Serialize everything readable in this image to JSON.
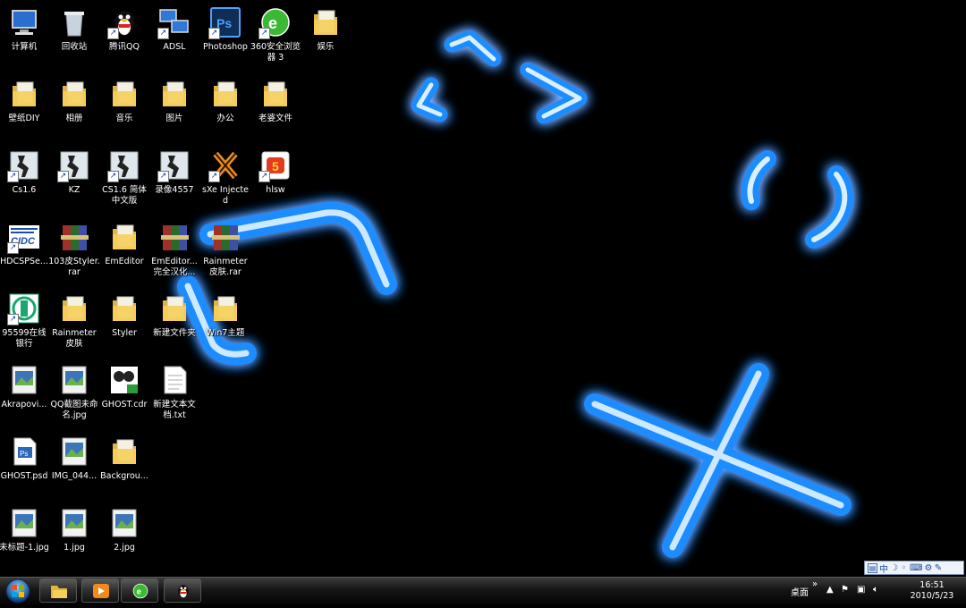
{
  "desktop": {
    "icons": [
      {
        "label": "计算机",
        "icon": "computer-icon"
      },
      {
        "label": "回收站",
        "icon": "recycle-bin-icon"
      },
      {
        "label": "腾讯QQ",
        "icon": "qq-penguin-icon"
      },
      {
        "label": "ADSL",
        "icon": "network-icon"
      },
      {
        "label": "Photoshop",
        "icon": "photoshop-icon"
      },
      {
        "label": "360安全浏览器 3",
        "icon": "browser-360-icon"
      },
      {
        "label": "娱乐",
        "icon": "folder-icon"
      },
      {
        "label": "壁纸DIY",
        "icon": "folder-icon"
      },
      {
        "label": "相册",
        "icon": "folder-icon"
      },
      {
        "label": "音乐",
        "icon": "folder-icon"
      },
      {
        "label": "图片",
        "icon": "folder-icon"
      },
      {
        "label": "办公",
        "icon": "folder-icon"
      },
      {
        "label": "老婆文件",
        "icon": "folder-icon"
      },
      {
        "label": "Cs1.6",
        "icon": "counter-strike-icon"
      },
      {
        "label": "KZ",
        "icon": "counter-strike-icon"
      },
      {
        "label": "CS1.6 简体中文版",
        "icon": "counter-strike-icon"
      },
      {
        "label": "录像4557",
        "icon": "counter-strike-icon"
      },
      {
        "label": "sXe Injected",
        "icon": "sxe-icon"
      },
      {
        "label": "hlsw",
        "icon": "hlsw-icon"
      },
      {
        "label": "HDCSPSe...",
        "icon": "cidc-icon"
      },
      {
        "label": "103皮Styler.rar",
        "icon": "rar-archive-icon"
      },
      {
        "label": "EmEditor",
        "icon": "folder-icon"
      },
      {
        "label": "EmEditor...完全汉化...",
        "icon": "rar-archive-icon"
      },
      {
        "label": "Rainmeter皮肤.rar",
        "icon": "rar-archive-icon"
      },
      {
        "label": "95599在线银行",
        "icon": "bank-icon"
      },
      {
        "label": "Rainmeter皮肤",
        "icon": "folder-icon"
      },
      {
        "label": "Styler",
        "icon": "folder-icon"
      },
      {
        "label": "新建文件夹",
        "icon": "folder-icon"
      },
      {
        "label": "Win7主题",
        "icon": "folder-icon"
      },
      {
        "label": "Akrapovi...",
        "icon": "image-file-icon"
      },
      {
        "label": "QQ截图未命名.jpg",
        "icon": "image-file-icon"
      },
      {
        "label": "GHOST.cdr",
        "icon": "coreldraw-file-icon"
      },
      {
        "label": "新建文本文档.txt",
        "icon": "text-file-icon"
      },
      {
        "label": "GHOST.psd",
        "icon": "psd-file-icon"
      },
      {
        "label": "IMG_044...",
        "icon": "image-file-icon"
      },
      {
        "label": "Backgrou...",
        "icon": "folder-icon"
      },
      {
        "label": "未标题-1.jpg",
        "icon": "image-file-icon"
      },
      {
        "label": "1.jpg",
        "icon": "image-file-icon"
      },
      {
        "label": "2.jpg",
        "icon": "image-file-icon"
      }
    ]
  },
  "taskbar": {
    "pinned": [
      {
        "icon": "windows-explorer-icon"
      },
      {
        "icon": "media-player-icon"
      },
      {
        "icon": "browser-360-icon"
      },
      {
        "icon": "qq-penguin-icon"
      }
    ],
    "desktop_label": "桌面",
    "chevron": "»",
    "tray_icons": [
      "show-hidden-icons",
      "action-center-flag-icon",
      "network-icon",
      "volume-icon"
    ],
    "clock": {
      "time": "16:51",
      "date": "2010/5/23"
    }
  },
  "language_bar": {
    "ime_label": "中",
    "icon": "ime-icon"
  },
  "colors": {
    "accent_blue": "#1a9cff",
    "taskbar": "#111111"
  }
}
